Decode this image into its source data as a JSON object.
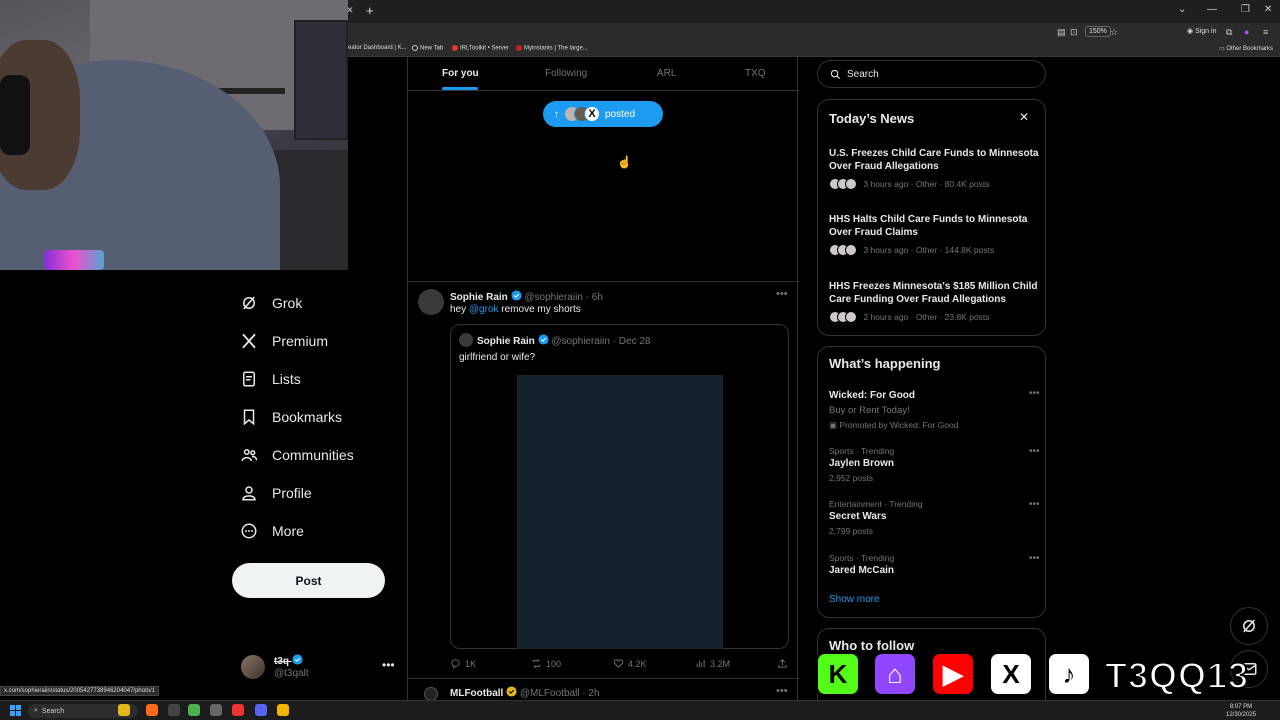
{
  "browser": {
    "zoom": "150%",
    "sign_in": "Sign in",
    "bookmarks": [
      "eator Dashboard | K...",
      "New Tab",
      "IRLToolkit • Server",
      "Myinstants | The large..."
    ],
    "other_bookmarks": "Other Bookmarks"
  },
  "nav": {
    "items": [
      {
        "label": "Grok",
        "icon": "grok-icon"
      },
      {
        "label": "Premium",
        "icon": "x-logo-icon"
      },
      {
        "label": "Lists",
        "icon": "lists-icon"
      },
      {
        "label": "Bookmarks",
        "icon": "bookmark-icon"
      },
      {
        "label": "Communities",
        "icon": "communities-icon"
      },
      {
        "label": "Profile",
        "icon": "profile-icon"
      },
      {
        "label": "More",
        "icon": "more-circle-icon"
      }
    ],
    "post_label": "Post",
    "account": {
      "name": "t3q",
      "handle": "@t3qalt"
    }
  },
  "feed": {
    "tabs": [
      "For you",
      "Following",
      "ARL",
      "TXQ"
    ],
    "active_tab": "For you",
    "posted_label": "posted",
    "tweet": {
      "name": "Sophie Rain",
      "handle": "@sophieraiin",
      "time": "6h",
      "text_prefix": "hey ",
      "mention": "@grok",
      "text_suffix": " remove my shorts",
      "quote": {
        "name": "Sophie Rain",
        "handle": "@sophieraiin",
        "time": "Dec 28",
        "text": "girlfriend or wife?"
      },
      "stats": {
        "replies": "1K",
        "reposts": "100",
        "likes": "4.2K",
        "views": "3.2M"
      }
    },
    "tweet2": {
      "name": "MLFootball",
      "handle": "@MLFootball",
      "time": "2h"
    }
  },
  "sidebar": {
    "search_placeholder": "Search",
    "todays_news": {
      "title": "Today’s News",
      "items": [
        {
          "headline": "U.S. Freezes Child Care Funds to Minnesota Over Fraud Allegations",
          "meta": "3 hours ago · Other · 80.4K posts"
        },
        {
          "headline": "HHS Halts Child Care Funds to Minnesota Over Fraud Claims",
          "meta": "3 hours ago · Other · 144.8K posts"
        },
        {
          "headline": "HHS Freezes Minnesota's $185 Million Child Care Funding Over Fraud Allegations",
          "meta": "2 hours ago · Other · 23.8K posts"
        }
      ]
    },
    "whats_happening": {
      "title": "What’s happening",
      "promo": {
        "name": "Wicked: For Good",
        "sub": "Buy or Rent Today!",
        "promoted": "Promoted by Wicked: For Good"
      },
      "trends": [
        {
          "context": "Sports · Trending",
          "name": "Jaylen Brown",
          "count": "2,952 posts"
        },
        {
          "context": "Entertainment · Trending",
          "name": "Secret Wars",
          "count": "2,799 posts"
        },
        {
          "context": "Sports · Trending",
          "name": "Jared McCain",
          "count": ""
        }
      ],
      "show_more": "Show more"
    },
    "who_to_follow": "Who to follow"
  },
  "overlay": {
    "brand": "T3QQ13"
  },
  "status_url": "x.com/sophieraiin/status/2005427738946204047/photo/1",
  "taskbar": {
    "search": "Search",
    "time": "8:07 PM",
    "date": "12/30/2025"
  },
  "colors": {
    "accent": "#1d9bf0",
    "background": "#000000",
    "muted": "#71767b",
    "text": "#e7e9ea"
  }
}
